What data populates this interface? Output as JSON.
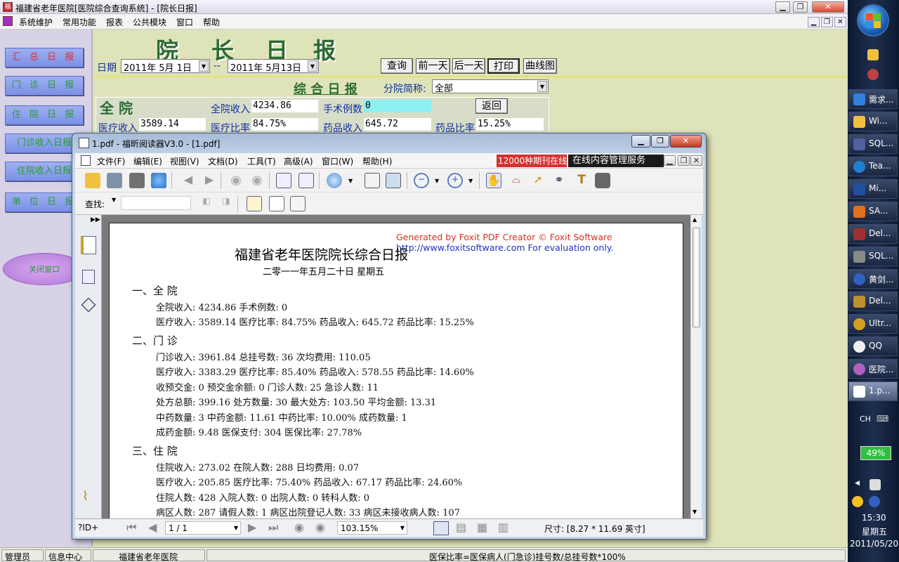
{
  "app": {
    "title": "福建省老年医院[医院综合查询系统] - [院长日报]",
    "menu": [
      "系统维护",
      "常用功能",
      "报表",
      "公共模块",
      "窗口",
      "帮助"
    ]
  },
  "left_nav": {
    "items": [
      "汇 总 日 报",
      "门 诊 日 报",
      "住 院 日 报",
      "门诊收入日报",
      "住院收入日报",
      "单 位 日 报"
    ],
    "ellipse_label": "关闭窗口"
  },
  "report": {
    "big_title": [
      "院",
      "长",
      "日",
      "报"
    ],
    "date_label": "日期",
    "date_from": "2011年 5月 1日",
    "date_sep": "--",
    "date_to": "2011年 5月13日",
    "buttons": [
      "查询",
      "前一天",
      "后一天",
      "打印",
      "曲线图"
    ],
    "subtitle": "综 合 日 报",
    "branch_label": "分院简称:",
    "branch_value": "全部",
    "section": "全 院",
    "total_income_label": "全院收入",
    "total_income": "4234.86",
    "surgery_label": "手术例数",
    "surgery": "0",
    "back_button": "返回",
    "medical_income_label": "医疗收入",
    "medical_income": "3589.14",
    "medical_ratio_label": "医疗比率",
    "medical_ratio": "84.75%",
    "drug_income_label": "药品收入",
    "drug_income": "645.72",
    "drug_ratio_label": "药品比率",
    "drug_ratio": "15.25%"
  },
  "statusbar": {
    "user": "管理员",
    "dept": "信息中心",
    "hospital": "福建省老年医院",
    "message": "医保比率=医保病人(门急诊)挂号数/总挂号数*100%"
  },
  "pdf": {
    "title": "1.pdf - 福昕阅读器V3.0 - [1.pdf]",
    "menu": [
      "文件(F)",
      "编辑(E)",
      "视图(V)",
      "文档(D)",
      "工具(T)",
      "高级(A)",
      "窗口(W)",
      "帮助(H)"
    ],
    "ad_red": "12000种期刊在线看",
    "ad_black": "在线内容管理服务",
    "find_label": "查找:",
    "watermark1": "Generated by Foxit PDF Creator © Foxit Software",
    "watermark2": "http://www.foxitsoftware.com   For evaluation only.",
    "doc_title": "福建省老年医院院长综合日报",
    "doc_date": "二零一一年五月二十日   星期五",
    "sections": [
      {
        "head": "一、全  院",
        "lines": [
          "全院收入: 4234.86 手术例数: 0",
          "医疗收入: 3589.14 医疗比率: 84.75% 药品收入: 645.72 药品比率: 15.25%"
        ]
      },
      {
        "head": "二、门  诊",
        "lines": [
          "门诊收入: 3961.84 总挂号数: 36 次均费用: 110.05",
          "医疗收入: 3383.29 医疗比率: 85.40% 药品收入: 578.55 药品比率: 14.60%",
          "收预交金: 0 预交金余额: 0 门诊人数: 25 急诊人数: 11",
          "处方总额: 399.16 处方数量: 30 最大处方: 103.50 平均金额: 13.31",
          "中药数量: 3 中药金额: 11.61 中药比率: 10.00% 成药数量: 1",
          "成药金额: 9.48 医保支付: 304 医保比率: 27.78%"
        ]
      },
      {
        "head": "三、住  院",
        "lines": [
          "住院收入: 273.02 在院人数: 288 日均费用: 0.07",
          "医疗收入: 205.85 医疗比率: 75.40% 药品收入: 67.17 药品比率: 24.60%",
          "住院人数: 428 入院人数: 0 出院人数: 0 转科人数: 0",
          "病区人数: 287 请假人数: 1 病区出院登记人数: 33 病区未接收病人数: 107"
        ]
      }
    ],
    "status_left": "?ID+",
    "page_indicator": "1 / 1",
    "zoom": "103.15%",
    "size": "尺寸: [8.27 * 11.69 英寸]"
  },
  "taskbar": {
    "items": [
      "需求...",
      "Wi...",
      "SQL...",
      "Tea...",
      "Mi...",
      "SA...",
      "Del...",
      "SQL...",
      "黄剑...",
      "Del...",
      "Ultr...",
      "QQ",
      "医院...",
      "1.p..."
    ],
    "lang": "CH",
    "battery": "49%",
    "time": "15:30",
    "weekday": "星期五",
    "date": "2011/05/20"
  },
  "colors": {
    "accent_green": "#2b6a33",
    "label_blue": "#1030a0",
    "nav_blue": "#7a90e8"
  }
}
